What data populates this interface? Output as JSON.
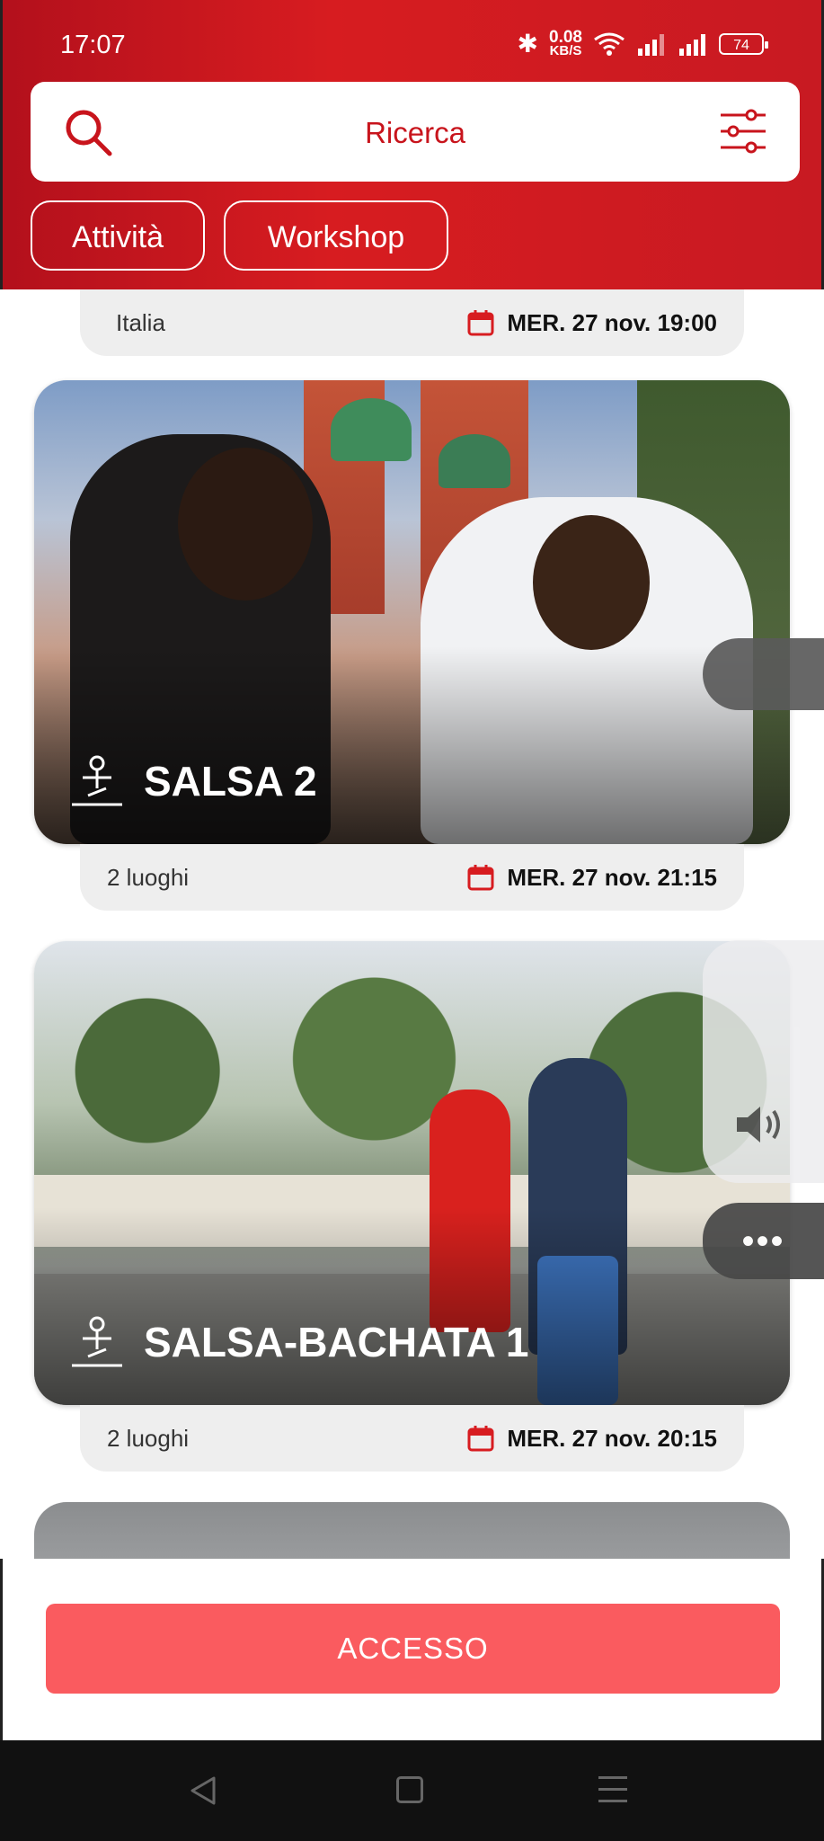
{
  "status_bar": {
    "time": "17:07",
    "network_speed": "0.08",
    "network_unit": "KB/S",
    "battery": "74"
  },
  "search": {
    "placeholder": "Ricerca"
  },
  "chips": [
    {
      "label": "Attività"
    },
    {
      "label": "Workshop"
    }
  ],
  "events": [
    {
      "place": "Italia",
      "date": "MER. 27 nov. 19:00"
    },
    {
      "title": "SALSA 2",
      "place": "2 luoghi",
      "date": "MER. 27 nov. 21:15"
    },
    {
      "title": "SALSA-BACHATA 1",
      "place": "2 luoghi",
      "date": "MER. 27 nov. 20:15"
    }
  ],
  "bottom": {
    "access_label": "ACCESSO"
  },
  "colors": {
    "brand_red": "#d71c20",
    "access_button": "#fa5b5f"
  }
}
